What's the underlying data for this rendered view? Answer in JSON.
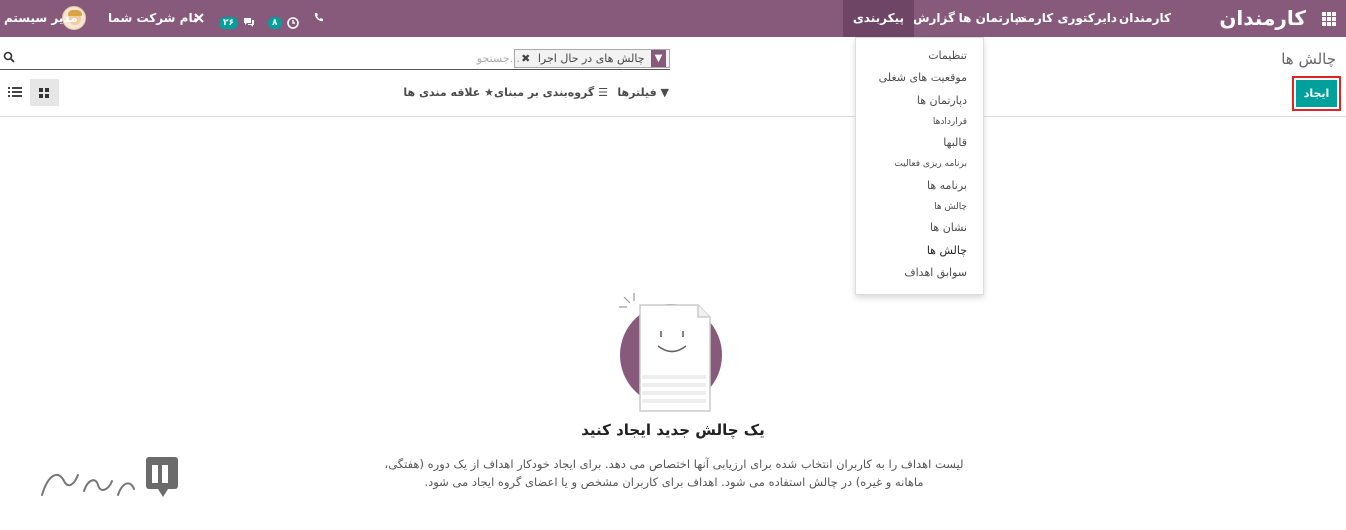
{
  "navbar": {
    "brand": "کارمندان",
    "menu": [
      "کارمندان",
      "دایرکتوری کارمند",
      "دپارتمان ها",
      "گزارش",
      "پیکربندی"
    ],
    "company": "نام شرکت شما",
    "user": "مدیر سیستم",
    "badge_messages": "۲۶",
    "badge_activities": "۸"
  },
  "control_panel": {
    "title": "چالش ها",
    "facet": "چالش های در حال اجرا",
    "search_placeholder": "جستجو...",
    "create_label": "ایجاد",
    "filters_label": "فیلترها",
    "groupby_label": "گروه‌بندی بر مبنای",
    "favorites_label": "علاقه مندی ها"
  },
  "config_menu": {
    "items": [
      {
        "label": "تنظیمات",
        "size": "big"
      },
      {
        "label": "موقعیت های شغلی",
        "size": "big"
      },
      {
        "label": "دپارتمان ها",
        "size": "big"
      },
      {
        "label": "قراردادها",
        "size": "small"
      },
      {
        "label": "قالبها",
        "size": "big"
      },
      {
        "label": "برنامه ریزی فعالیت",
        "size": "small"
      },
      {
        "label": "برنامه ها",
        "size": "big"
      },
      {
        "label": "چالش ها",
        "size": "small"
      },
      {
        "label": "نشان ها",
        "size": "big"
      },
      {
        "label": "چالش ها",
        "size": "big",
        "highlighted": true
      },
      {
        "label": "سوابق اهداف",
        "size": "big"
      }
    ]
  },
  "empty_state": {
    "title": "یک چالش جدید ایجاد کنید",
    "description": "لیست اهداف را به کاربران انتخاب شده برای ارزیابی آنها اختصاص می دهد. برای ایجاد خودکار اهداف از یک دوره (هفتگی، ماهانه و غیره) در چالش استفاده می شود. اهداف برای کاربران مشخص و یا اعضای گروه ایجاد می شود."
  },
  "colors": {
    "navbar": "#875a7b",
    "primary": "#00a09d",
    "highlight_border": "#e02424"
  }
}
